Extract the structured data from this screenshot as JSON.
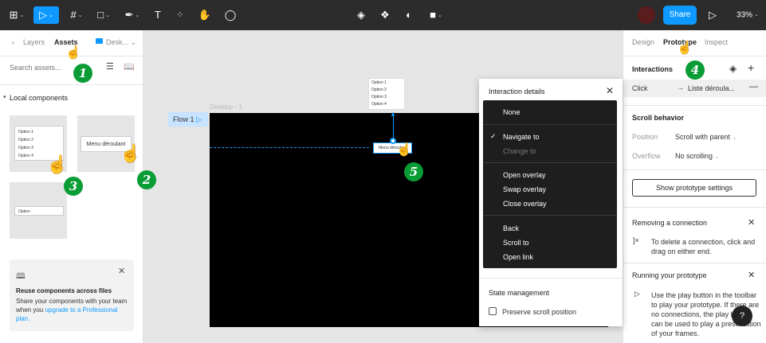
{
  "toolbar": {
    "share_label": "Share",
    "zoom_label": "33%",
    "text_tool_glyph": "T"
  },
  "left_panel": {
    "tab_layers": "Layers",
    "tab_assets": "Assets",
    "library_label": "Desk...",
    "search_placeholder": "Search assets...",
    "section_title": "Local components",
    "component_thumbs": [
      {
        "options": [
          "Option 1",
          "Option 2",
          "Option 3",
          "Option 4"
        ]
      },
      {
        "label": "Menu déroulant"
      },
      {
        "label": "Option"
      }
    ],
    "promo": {
      "title": "Reuse components across files",
      "body": "Share your components with your team when you",
      "link": "upgrade to a Professional plan."
    }
  },
  "canvas": {
    "flow_label": "Flow 1",
    "frame_label": "Desktop - 1",
    "menu_options": [
      "Option 1",
      "Option 2",
      "Option 3",
      "Option 4"
    ],
    "menu_label": "Menu déroulant"
  },
  "interaction_popup": {
    "title": "Interaction details",
    "dropdown_items": [
      {
        "label": "None",
        "disabled": false,
        "checked": false
      },
      {
        "label": "Navigate to",
        "disabled": false,
        "checked": true
      },
      {
        "label": "Change to",
        "disabled": true,
        "checked": false
      },
      {
        "label": "Open overlay",
        "disabled": false,
        "checked": false
      },
      {
        "label": "Swap overlay",
        "disabled": false,
        "checked": false
      },
      {
        "label": "Close overlay",
        "disabled": false,
        "checked": false
      },
      {
        "label": "Back",
        "disabled": false,
        "checked": false
      },
      {
        "label": "Scroll to",
        "disabled": false,
        "checked": false
      },
      {
        "label": "Open link",
        "disabled": false,
        "checked": false
      }
    ],
    "state_title": "State management",
    "preserve_label": "Preserve scroll position"
  },
  "right_panel": {
    "tab_design": "Design",
    "tab_prototype": "Prototype",
    "tab_inspect": "Inspect",
    "interactions_title": "Interactions",
    "trigger": "Click",
    "action": "Liste déroula...",
    "scroll_title": "Scroll behavior",
    "position_label": "Position",
    "position_value": "Scroll with parent",
    "overflow_label": "Overflow",
    "overflow_value": "No scrolling",
    "settings_button": "Show prototype settings",
    "removing_title": "Removing a connection",
    "removing_text": "To delete a connection, click and drag on either end.",
    "running_title": "Running your prototype",
    "running_text": "Use the play button in the toolbar to play your prototype. If there are no connections, the play button can be used to play a presentation of your frames.",
    "help_label": "?"
  },
  "steps": [
    "1",
    "2",
    "3",
    "4",
    "5"
  ],
  "colors": {
    "accent": "#0d99ff",
    "step_green": "#0a9d36",
    "toolbar_bg": "#2c2c2c"
  }
}
